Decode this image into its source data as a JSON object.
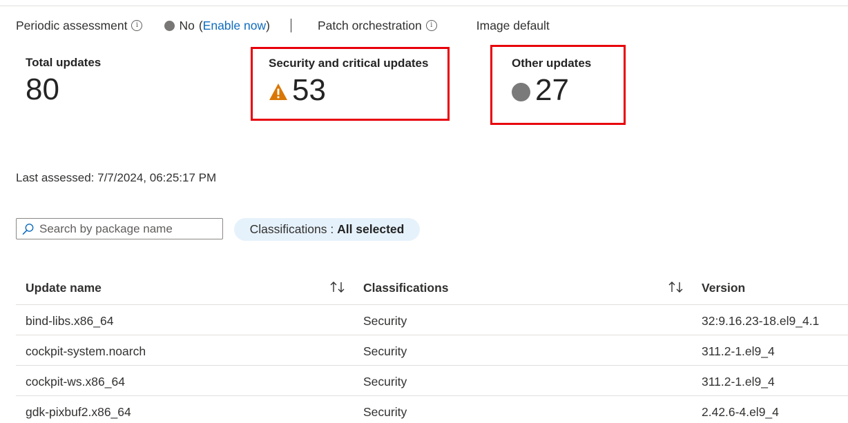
{
  "status": {
    "periodic_assessment_label": "Periodic assessment",
    "periodic_value": "No",
    "paren_open": "(",
    "enable_link": "Enable now",
    "paren_close": ")",
    "patch_orchestration_label": "Patch orchestration",
    "patch_orchestration_value": "Image default",
    "info_glyph": "i"
  },
  "cards": {
    "total": {
      "title": "Total updates",
      "value": "80"
    },
    "security": {
      "title": "Security and critical updates",
      "value": "53",
      "icon": "warning-icon",
      "icon_color": "#d97706"
    },
    "other": {
      "title": "Other updates",
      "value": "27",
      "icon": "gray-circle-icon"
    }
  },
  "last_assessed": "Last assessed: 7/7/2024, 06:25:17 PM",
  "search": {
    "placeholder": "Search by package name",
    "value": ""
  },
  "filter": {
    "label": "Classifications : ",
    "value": "All selected"
  },
  "table": {
    "columns": [
      "Update name",
      "Classifications",
      "Version"
    ],
    "rows": [
      {
        "name": "bind-libs.x86_64",
        "classification": "Security",
        "version": "32:9.16.23-18.el9_4.1"
      },
      {
        "name": "cockpit-system.noarch",
        "classification": "Security",
        "version": "311.2-1.el9_4"
      },
      {
        "name": "cockpit-ws.x86_64",
        "classification": "Security",
        "version": "311.2-1.el9_4"
      },
      {
        "name": "gdk-pixbuf2.x86_64",
        "classification": "Security",
        "version": "2.42.6-4.el9_4"
      }
    ]
  },
  "colors": {
    "highlight_border": "#e8000a",
    "link": "#0f6cbd",
    "pill_bg": "#e6f2fb",
    "warning": "#d97706"
  }
}
